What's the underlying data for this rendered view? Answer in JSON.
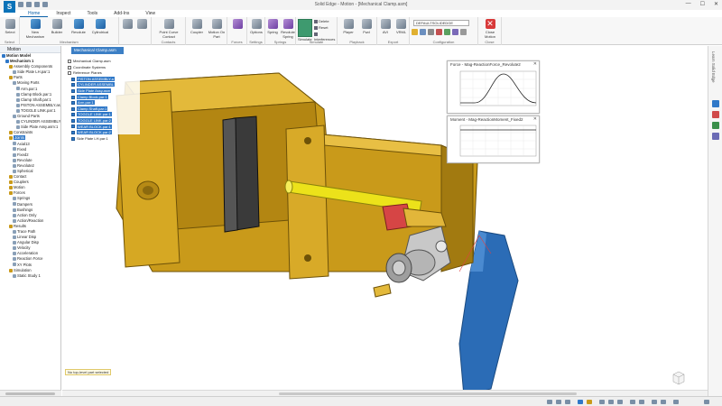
{
  "window": {
    "title": "Solid Edge - Motion - [Mechanical Clamp.asm]",
    "controls": [
      "—",
      "☐",
      "✕"
    ]
  },
  "ribbon_tabs": [
    "Home",
    "Inspect",
    "Tools",
    "Add-Ins",
    "View"
  ],
  "ribbon": {
    "groups": {
      "select": "Select",
      "mechanism": "Mechanism",
      "contacts": "Contacts",
      "forces": "Forces",
      "settings": "Settings",
      "springs": "Springs",
      "simulate": "Simulate",
      "playback": "Playback",
      "export": "Export",
      "configuration": "Configuration",
      "close": "Close"
    },
    "buttons": {
      "select": "Select",
      "new_mechanism": "New Mechanism",
      "builder": "Builder",
      "revolute": "Revolute",
      "cylindrical": "Cylindrical",
      "point_curve": "Point Curve Contact",
      "coupler": "Coupler",
      "motion_on_part": "Motion On Part",
      "options": "Options",
      "spring": "Spring",
      "revolute_spring": "Revolute Spring",
      "simulate": "Simulate",
      "delete": "Delete",
      "reset": "Reset",
      "interferences": "Interferences",
      "player": "Player",
      "fwd": "Fwd",
      "avi": "AVI",
      "vrml": "VRML",
      "close_motion": "Close Motion"
    },
    "config_select": "DEFAULTSOLIDEDGE"
  },
  "left_pane": {
    "title": "Motion",
    "tree": [
      {
        "label": "Motion Model",
        "indent": 0,
        "bold": true
      },
      {
        "label": "Mechanism 1",
        "indent": 1,
        "bold": true
      },
      {
        "label": "Assembly Components",
        "indent": 2
      },
      {
        "label": "Side Plate LH.par:1",
        "indent": 3
      },
      {
        "label": "Parts",
        "indent": 2
      },
      {
        "label": "Moving Parts",
        "indent": 3
      },
      {
        "label": "Arm.par:1",
        "indent": 4
      },
      {
        "label": "Clamp Block.par:1",
        "indent": 4
      },
      {
        "label": "Clamp Shaft.par:1",
        "indent": 4
      },
      {
        "label": "PISTON ASSEMBLY.asm",
        "indent": 4
      },
      {
        "label": "TOGGLE LINK.par:1",
        "indent": 4
      },
      {
        "label": "Ground Parts",
        "indent": 3
      },
      {
        "label": "CYLINDER ASSEMBLY",
        "indent": 4
      },
      {
        "label": "Side Plate Assy.asm:1",
        "indent": 4
      },
      {
        "label": "Constraints",
        "indent": 2
      },
      {
        "label": "Joints",
        "indent": 2,
        "selected": true
      },
      {
        "label": "Axial13",
        "indent": 3
      },
      {
        "label": "Fixed",
        "indent": 3
      },
      {
        "label": "Fixed2",
        "indent": 3
      },
      {
        "label": "Revolute",
        "indent": 3
      },
      {
        "label": "Revolute2",
        "indent": 3
      },
      {
        "label": "Spherical",
        "indent": 3
      },
      {
        "label": "Contact",
        "indent": 2
      },
      {
        "label": "Couplers",
        "indent": 2
      },
      {
        "label": "Motion",
        "indent": 2
      },
      {
        "label": "Forces",
        "indent": 2
      },
      {
        "label": "Springs",
        "indent": 3
      },
      {
        "label": "Dampers",
        "indent": 3
      },
      {
        "label": "Bushings",
        "indent": 3
      },
      {
        "label": "Action Only",
        "indent": 3
      },
      {
        "label": "Action/Reaction",
        "indent": 3
      },
      {
        "label": "Results",
        "indent": 2
      },
      {
        "label": "Trace Path",
        "indent": 3
      },
      {
        "label": "Linear Disp",
        "indent": 3
      },
      {
        "label": "Angular Disp",
        "indent": 3
      },
      {
        "label": "Velocity",
        "indent": 3
      },
      {
        "label": "Acceleration",
        "indent": 3
      },
      {
        "label": "Reaction Force",
        "indent": 3
      },
      {
        "label": "XY Plots",
        "indent": 3
      },
      {
        "label": "Simulation",
        "indent": 2
      },
      {
        "label": "Static Study 1",
        "indent": 3
      }
    ]
  },
  "document_tab": "Mechanical Clamp.asm",
  "pathfinder": [
    {
      "label": "Mechanical Clamp.asm",
      "checked": false
    },
    {
      "label": "Coordinate Systems",
      "checked": false
    },
    {
      "label": "Reference Planes",
      "checked": false
    },
    {
      "label": "PISTON ASSEMBLY.a",
      "checked": true,
      "pill": true
    },
    {
      "label": "CYLINDER ASSEMBL",
      "checked": true,
      "pill": true
    },
    {
      "label": "Side Plate Assy.asm",
      "checked": true,
      "pill": true
    },
    {
      "label": "Clamp Block.par:1",
      "checked": true,
      "pill": true
    },
    {
      "label": "Arm.par:1",
      "checked": true,
      "pill": true
    },
    {
      "label": "Clamp Shaft.par:1",
      "checked": true,
      "pill": true
    },
    {
      "label": "TOGGLE LINK.par:1",
      "checked": true,
      "pill": true
    },
    {
      "label": "TOGGLE LINK.par:2",
      "checked": true,
      "pill": true
    },
    {
      "label": "WEAR BLOCK.par:1",
      "checked": true,
      "pill": true
    },
    {
      "label": "WEAR BLOCK.par:2",
      "checked": true,
      "pill": true
    },
    {
      "label": "Side Plate LH.par:1",
      "checked": true,
      "pill": false
    }
  ],
  "plots": [
    {
      "title": "Force - Mag-ReactionForce_Revolute2"
    },
    {
      "title": "Moment - Mag-ReactionMoment_Fixed2"
    }
  ],
  "status_message": "No top-level part selected",
  "right_dock_label": "Learn Solid Edge",
  "colors": {
    "accent": "#2f78c8",
    "brass": "#c99a1a",
    "arm_blue": "#2b6cb6",
    "shaft_yellow": "#e9e21c",
    "red_part": "#d64545"
  }
}
